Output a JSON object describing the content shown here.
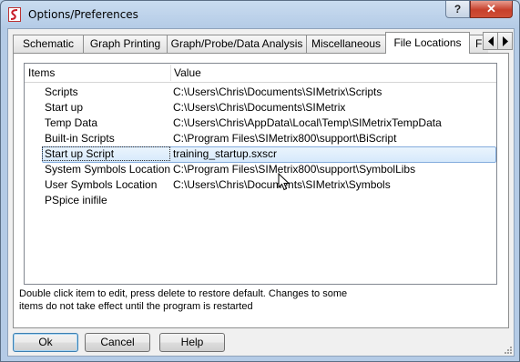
{
  "window": {
    "title": "Options/Preferences",
    "help_label": "?",
    "close_label": "✕"
  },
  "tabs": [
    {
      "label": "Schematic"
    },
    {
      "label": "Graph Printing"
    },
    {
      "label": "Graph/Probe/Data Analysis"
    },
    {
      "label": "Miscellaneous"
    },
    {
      "label": "File Locations",
      "active": true
    },
    {
      "label": "Fil"
    }
  ],
  "tree": {
    "columns": [
      "Items",
      "Value"
    ],
    "rows": [
      {
        "item": "Scripts",
        "value": "C:\\Users\\Chris\\Documents\\SIMetrix\\Scripts"
      },
      {
        "item": "Start up",
        "value": "C:\\Users\\Chris\\Documents\\SIMetrix"
      },
      {
        "item": "Temp Data",
        "value": "C:\\Users\\Chris\\AppData\\Local\\Temp\\SIMetrixTempData"
      },
      {
        "item": "Built-in Scripts",
        "value": "C:\\Program Files\\SIMetrix800\\support\\BiScript"
      },
      {
        "item": "Start up Script",
        "value": "training_startup.sxscr",
        "selected": true
      },
      {
        "item": "System Symbols Location",
        "value": "C:\\Program Files\\SIMetrix800\\support\\SymbolLibs"
      },
      {
        "item": "User Symbols Location",
        "value": "C:\\Users\\Chris\\Documents\\SIMetrix\\Symbols"
      },
      {
        "item": "PSpice inifile",
        "value": ""
      }
    ]
  },
  "note": {
    "line1": "Double click item to edit, press delete to restore default. Changes to some",
    "line2": "items do not take effect until the program is restarted"
  },
  "buttons": {
    "ok": "Ok",
    "cancel": "Cancel",
    "help": "Help"
  },
  "colors": {
    "selection_border": "#84acdd",
    "close_button": "#c7402b"
  }
}
